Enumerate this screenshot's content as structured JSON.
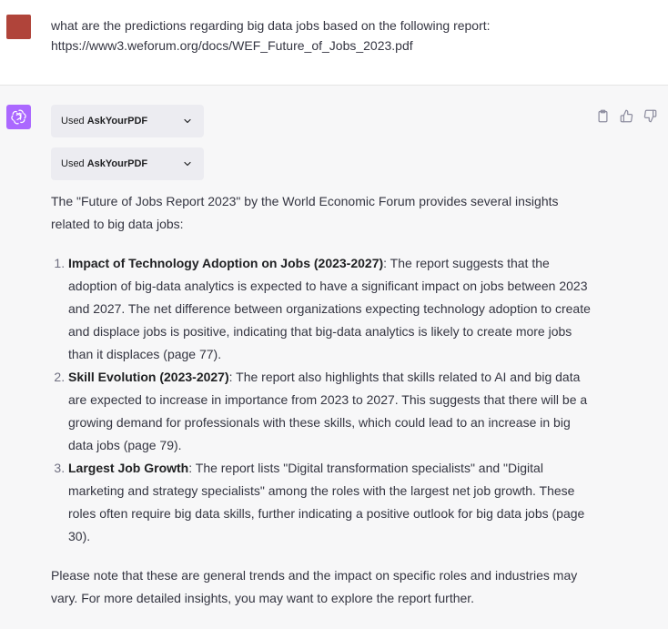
{
  "user_message": {
    "line1": "what are the predictions regarding big data jobs based on the following report:",
    "line2": "https://www3.weforum.org/docs/WEF_Future_of_Jobs_2023.pdf"
  },
  "plugins": [
    {
      "used_label": "Used",
      "name": "AskYourPDF"
    },
    {
      "used_label": "Used",
      "name": "AskYourPDF"
    }
  ],
  "actions": {
    "copy_icon": "clipboard-icon",
    "like_icon": "thumbs-up-icon",
    "dislike_icon": "thumbs-down-icon"
  },
  "answer": {
    "intro": "The \"Future of Jobs Report 2023\" by the World Economic Forum provides several insights related to big data jobs:",
    "items": [
      {
        "title": "Impact of Technology Adoption on Jobs (2023-2027)",
        "text": ": The report suggests that the adoption of big-data analytics is expected to have a significant impact on jobs between 2023 and 2027. The net difference between organizations expecting technology adoption to create and displace jobs is positive, indicating that big-data analytics is likely to create more jobs than it displaces (page 77)."
      },
      {
        "title": "Skill Evolution (2023-2027)",
        "text": ": The report also highlights that skills related to AI and big data are expected to increase in importance from 2023 to 2027. This suggests that there will be a growing demand for professionals with these skills, which could lead to an increase in big data jobs (page 79)."
      },
      {
        "title": "Largest Job Growth",
        "text": ": The report lists \"Digital transformation specialists\" and \"Digital marketing and strategy specialists\" among the roles with the largest net job growth. These roles often require big data skills, further indicating a positive outlook for big data jobs (page 30)."
      }
    ],
    "closing": "Please note that these are general trends and the impact on specific roles and industries may vary. For more detailed insights, you may want to explore the report further."
  },
  "colors": {
    "user_avatar": "#b0443a",
    "assistant_avatar": "#ab68ff",
    "chip_bg": "#ececf1",
    "assistant_bg": "#f7f7f8"
  }
}
